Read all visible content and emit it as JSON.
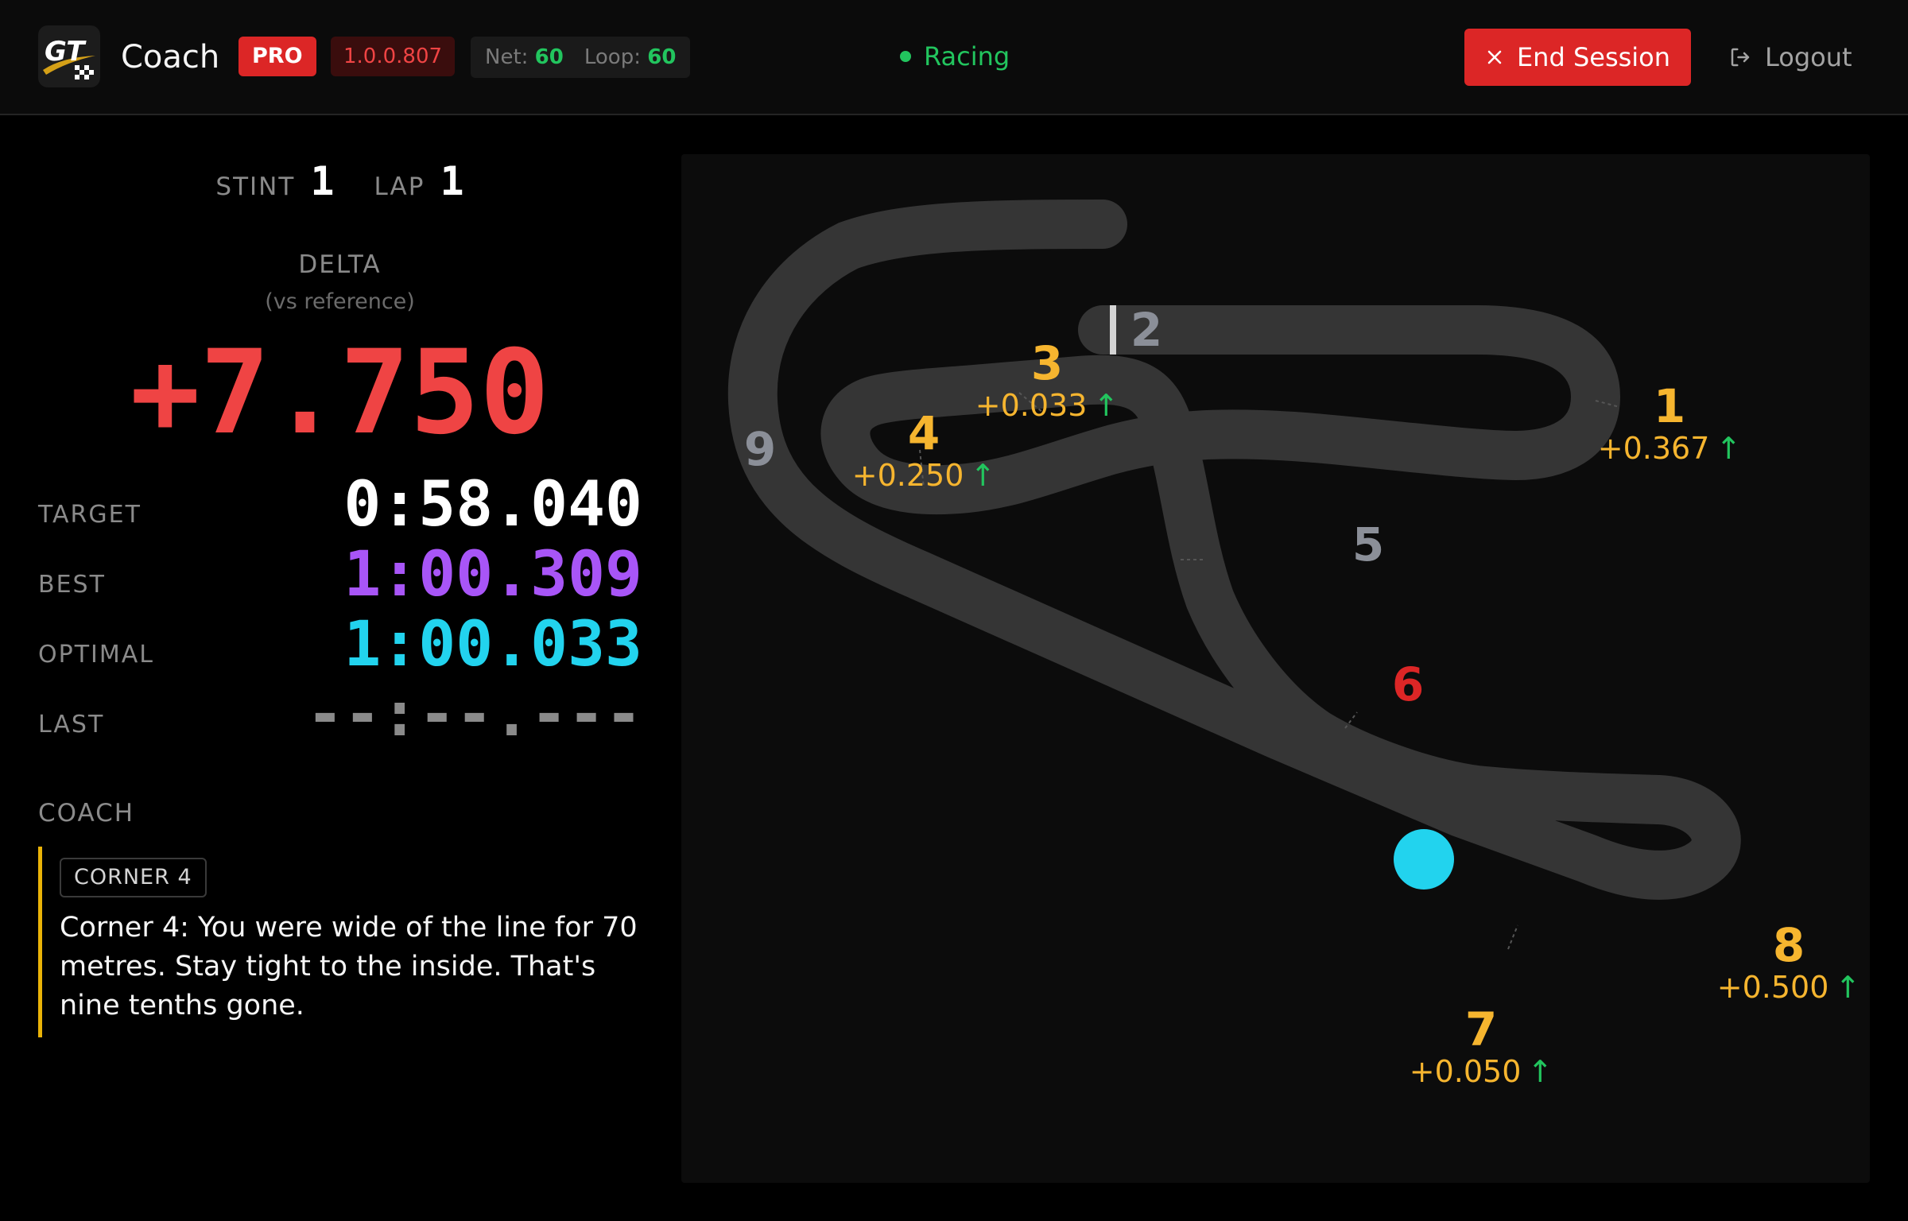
{
  "header": {
    "app_title": "Coach",
    "logo_text": "GT",
    "plan_badge": "PRO",
    "version": "1.0.0.807",
    "net_label": "Net:",
    "net_value": "60",
    "loop_label": "Loop:",
    "loop_value": "60",
    "status": "Racing",
    "end_session_label": "End Session",
    "logout_label": "Logout"
  },
  "session": {
    "stint_label": "STINT",
    "stint": "1",
    "lap_label": "LAP",
    "lap": "1",
    "delta_label": "DELTA",
    "delta_sub": "(vs reference)",
    "delta": "+7.750"
  },
  "times": [
    {
      "label": "TARGET",
      "value": "0:58.040",
      "color": "#ffffff"
    },
    {
      "label": "BEST",
      "value": "1:00.309",
      "color": "#a855f7"
    },
    {
      "label": "OPTIMAL",
      "value": "1:00.033",
      "color": "#22d3ee"
    },
    {
      "label": "LAST",
      "value": "--:--.---",
      "color": "#8a8a8a"
    }
  ],
  "coach": {
    "label": "COACH",
    "corner_tag": "CORNER 4",
    "message": "Corner 4: You were wide of the line for 70 metres. Stay tight to the inside. That's nine tenths gone."
  },
  "map": {
    "corners": [
      {
        "num": "1",
        "delta": "+0.367",
        "arrow": "↑"
      },
      {
        "num": "2"
      },
      {
        "num": "3",
        "delta": "+0.033",
        "arrow": "↑"
      },
      {
        "num": "4",
        "delta": "+0.250",
        "arrow": "↑"
      },
      {
        "num": "5"
      },
      {
        "num": "6"
      },
      {
        "num": "7",
        "delta": "+0.050",
        "arrow": "↑"
      },
      {
        "num": "8",
        "delta": "+0.500",
        "arrow": "↑"
      },
      {
        "num": "9"
      }
    ],
    "colors": {
      "track": "#353535",
      "car": "#22d3ee",
      "corner_slower": "#f6b52f",
      "corner_neutral": "#8b8f98",
      "corner_active": "#dc2626",
      "gain_arrow": "#22c55e"
    }
  }
}
